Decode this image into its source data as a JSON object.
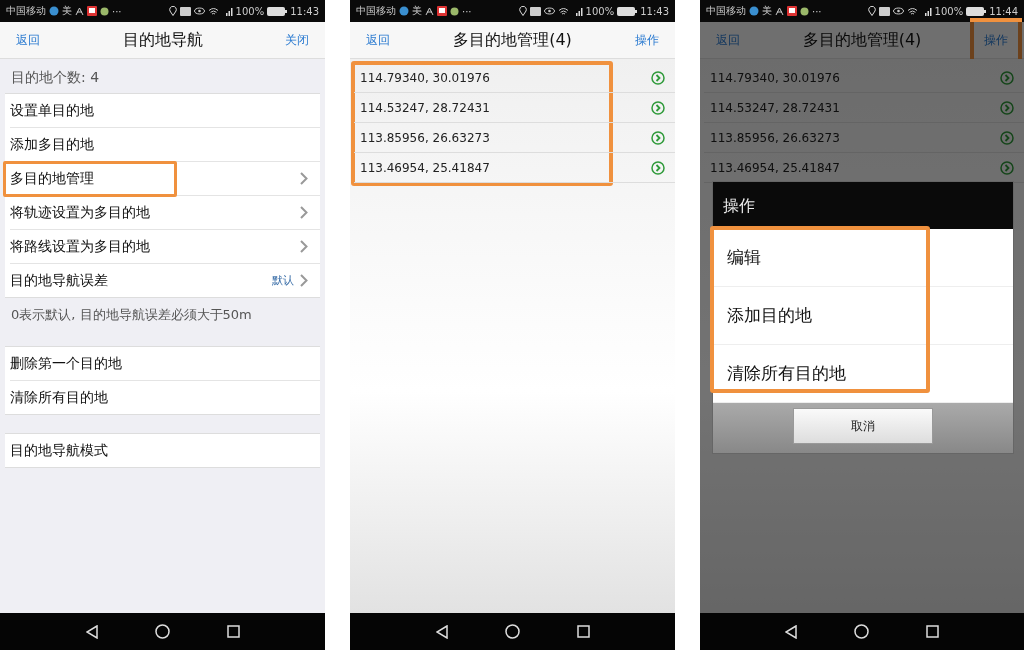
{
  "screens": [
    {
      "kind": "settings",
      "status_bar": {
        "carrier": "中国移动",
        "app_glyph": "美",
        "more": "···",
        "battery": "100%",
        "time": "11:43"
      },
      "nav": {
        "back": "返回",
        "title": "目的地导航",
        "action": "关闭",
        "action_highlighted": false
      },
      "count_label": "目的地个数: 4",
      "groups": [
        {
          "rows": [
            {
              "label": "设置单目的地",
              "kind": "plain",
              "highlighted": false
            },
            {
              "label": "添加多目的地",
              "kind": "plain",
              "highlighted": false
            },
            {
              "label": "多目的地管理",
              "kind": "disclosure",
              "highlighted": true
            },
            {
              "label": "将轨迹设置为多目的地",
              "kind": "disclosure",
              "highlighted": false
            },
            {
              "label": "将路线设置为多目的地",
              "kind": "disclosure",
              "highlighted": false
            },
            {
              "label": "目的地导航误差",
              "kind": "value",
              "value": "默认",
              "highlighted": false
            }
          ],
          "footer": "0表示默认, 目的地导航误差必须大于50m"
        },
        {
          "rows": [
            {
              "label": "删除第一个目的地",
              "kind": "plain",
              "highlighted": false
            },
            {
              "label": "清除所有目的地",
              "kind": "plain",
              "highlighted": false
            }
          ]
        },
        {
          "rows": [
            {
              "label": "目的地导航模式",
              "kind": "plain",
              "highlighted": false
            }
          ]
        }
      ]
    },
    {
      "kind": "list",
      "status_bar": {
        "carrier": "中国移动",
        "app_glyph": "美",
        "more": "···",
        "battery": "100%",
        "time": "11:43"
      },
      "nav": {
        "back": "返回",
        "title": "多目的地管理(4)",
        "action": "操作",
        "action_highlighted": false
      },
      "list_highlighted": true,
      "rows": [
        "114.79340, 30.01976",
        "114.53247, 28.72431",
        "113.85956, 26.63273",
        "113.46954, 25.41847"
      ]
    },
    {
      "kind": "list",
      "status_bar": {
        "carrier": "中国移动",
        "app_glyph": "美",
        "more": "···",
        "battery": "100%",
        "time": "11:44"
      },
      "nav": {
        "back": "返回",
        "title": "多目的地管理(4)",
        "action": "操作",
        "action_highlighted": true
      },
      "rows": [
        "114.79340, 30.01976",
        "114.53247, 28.72431",
        "113.85956, 26.63273",
        "113.46954, 25.41847"
      ],
      "dialog": {
        "title": "操作",
        "items": [
          "编辑",
          "添加目的地",
          "清除所有目的地"
        ],
        "items_highlighted": true,
        "cancel": "取消"
      }
    }
  ]
}
